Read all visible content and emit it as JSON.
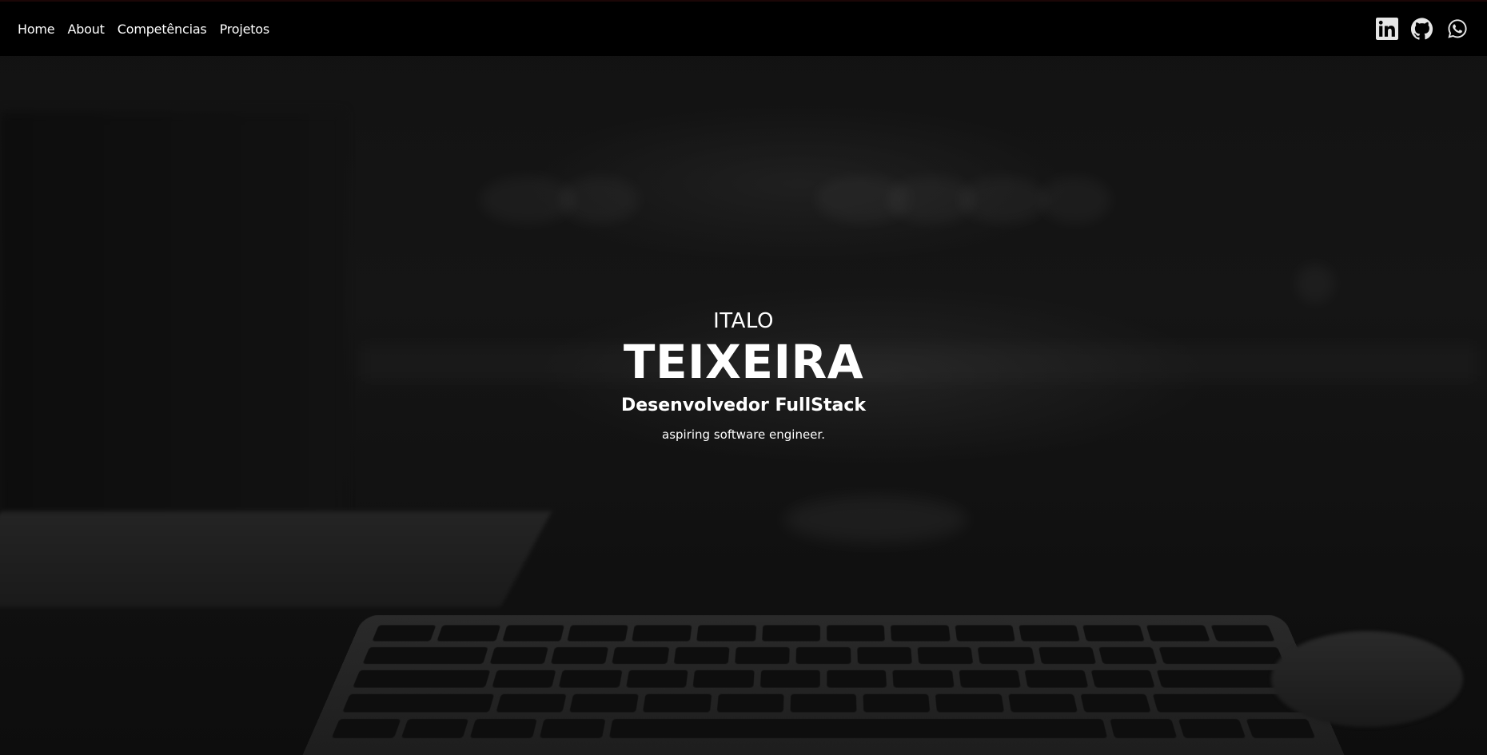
{
  "nav": {
    "links": [
      {
        "label": "Home"
      },
      {
        "label": "About"
      },
      {
        "label": "Competências"
      },
      {
        "label": "Projetos"
      }
    ]
  },
  "social": {
    "icons": [
      "linkedin-icon",
      "github-icon",
      "whatsapp-icon"
    ]
  },
  "hero": {
    "first_name": "ITALO",
    "last_name": "TEIXEIRA",
    "role": "Desenvolvedor FullStack",
    "tagline": "aspiring software engineer."
  },
  "colors": {
    "navbar_bg": "#000000",
    "text": "#ffffff",
    "icon": "#e6e6e6",
    "background": "#121212"
  }
}
